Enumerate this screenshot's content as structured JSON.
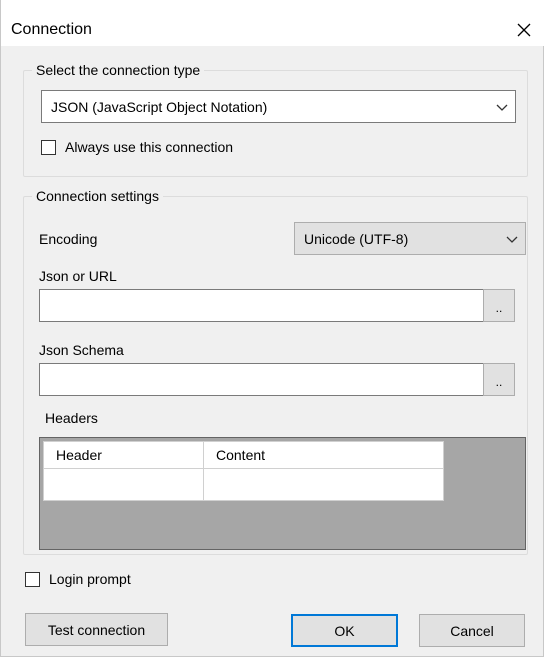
{
  "window": {
    "title": "Connection",
    "close_icon": "close-icon"
  },
  "connection_type": {
    "legend": "Select the connection type",
    "selected": "JSON (JavaScript Object Notation)",
    "always_use_label": "Always use this connection",
    "always_use_checked": false
  },
  "settings": {
    "legend": "Connection settings",
    "encoding_label": "Encoding",
    "encoding_value": "Unicode (UTF-8)",
    "json_url_label": "Json or URL",
    "json_url_value": "",
    "json_url_browse": "..",
    "schema_label": "Json Schema",
    "schema_value": "",
    "schema_browse": "..",
    "headers_label": "Headers",
    "headers_columns": [
      "Header",
      "Content"
    ],
    "headers_rows": [
      [
        "",
        ""
      ]
    ]
  },
  "login_prompt": {
    "label": "Login prompt",
    "checked": false
  },
  "buttons": {
    "test": "Test connection",
    "ok": "OK",
    "cancel": "Cancel"
  },
  "colors": {
    "accent": "#0078d7",
    "dialog_bg": "#f0f0f0",
    "grid_bg": "#a6a6a6"
  }
}
